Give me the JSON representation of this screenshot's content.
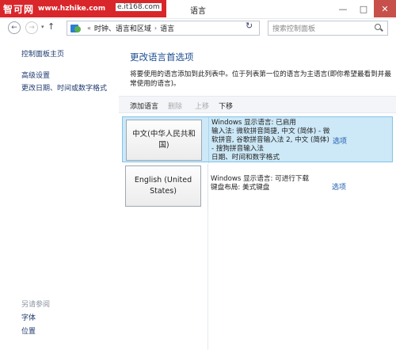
{
  "watermark": {
    "brand": "智可网",
    "url": "www.hzhike.com",
    "tail": "e.it168.com"
  },
  "window": {
    "title": "语言",
    "minimize_glyph": "—",
    "maximize_glyph": "□",
    "close_glyph": "✕"
  },
  "nav": {
    "back_glyph": "←",
    "forward_glyph": "→",
    "dropdown_glyph": "▾",
    "up_glyph": "↑",
    "refresh_glyph": "↻"
  },
  "address": {
    "separator": "«",
    "crumbs": [
      "时钟、语言和区域",
      "语言"
    ],
    "crumb_separator": "›",
    "dropdown_glyph": "▾"
  },
  "search": {
    "placeholder": "搜索控制面板"
  },
  "sidebar": {
    "home": "控制面板主页",
    "links": [
      "高级设置",
      "更改日期、时间或数字格式"
    ],
    "see_also_label": "另请参阅",
    "see_also_links": [
      "字体",
      "位置"
    ]
  },
  "main": {
    "title": "更改语言首选项",
    "description": "将要使用的语言添加到此列表中。位于列表第一位的语言为主语言(即你希望最看到并最常使用的语言)。",
    "toolbar": {
      "add": "添加语言",
      "remove": "删除",
      "move_up": "上移",
      "move_down": "下移"
    },
    "languages": [
      {
        "name": "中文(中华人民共和国)",
        "info": "Windows 显示语言: 已启用\n输入法: 微软拼音简捷, 中文 (简体) - 微软拼音, 谷歌拼音输入法 2, 中文 (简体) - 搜狗拼音输入法\n日期、时间和数字格式",
        "options": "选项",
        "selected": true
      },
      {
        "name": "English (United States)",
        "info": "Windows 显示语言: 可进行下载\n键盘布局: 美式键盘",
        "options": "选项",
        "selected": false
      }
    ]
  },
  "colors": {
    "selected_row_bg": "#cde8f7",
    "selected_row_border": "#7fc4ea",
    "link": "#1e5bb0",
    "title": "#1d4f91",
    "watermark_bg": "#d9262b",
    "close_button_bg": "#c7504a"
  }
}
